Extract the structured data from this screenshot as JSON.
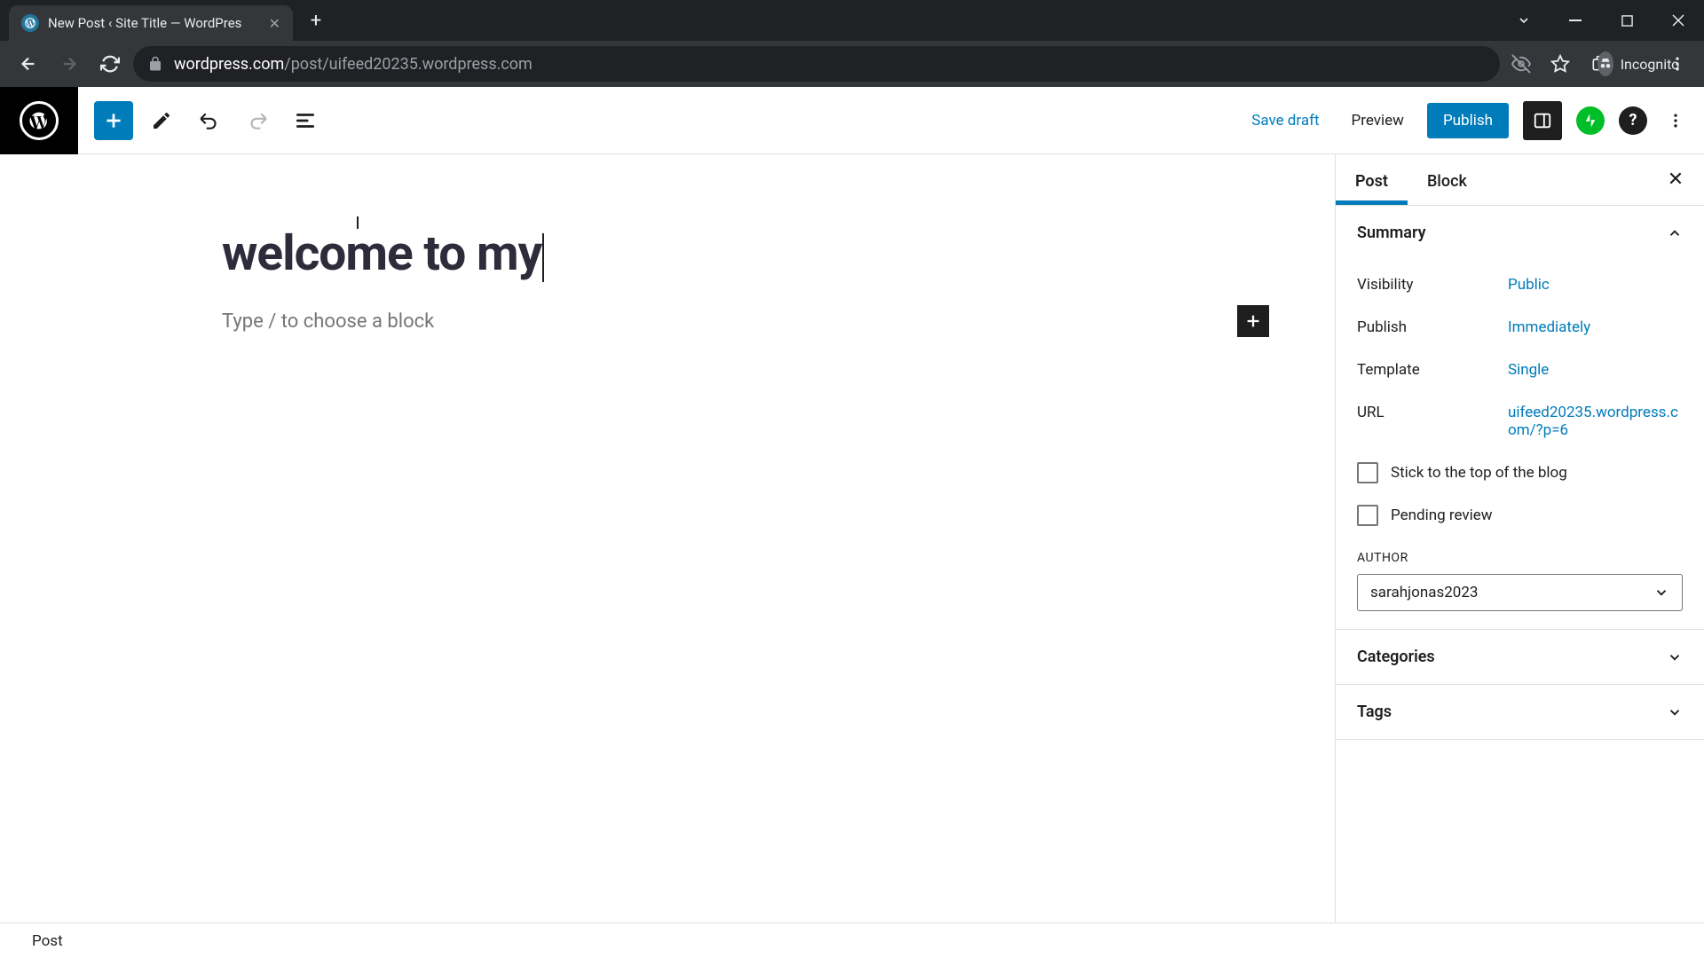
{
  "browser": {
    "tab_title": "New Post ‹ Site Title — WordPres",
    "url_domain": "wordpress.com",
    "url_path": "/post/uifeed20235.wordpress.com",
    "incognito_label": "Incognito"
  },
  "toolbar": {
    "save_draft": "Save draft",
    "preview": "Preview",
    "publish": "Publish"
  },
  "editor": {
    "title_value": "welcome to my",
    "block_placeholder": "Type / to choose a block"
  },
  "sidebar": {
    "tabs": {
      "post": "Post",
      "block": "Block"
    },
    "panels": {
      "summary": {
        "title": "Summary",
        "visibility_label": "Visibility",
        "visibility_value": "Public",
        "publish_label": "Publish",
        "publish_value": "Immediately",
        "template_label": "Template",
        "template_value": "Single",
        "url_label": "URL",
        "url_value": "uifeed20235.wordpress.com/?p=6",
        "stick_label": "Stick to the top of the blog",
        "pending_label": "Pending review",
        "author_heading": "AUTHOR",
        "author_value": "sarahjonas2023"
      },
      "categories": {
        "title": "Categories"
      },
      "tags": {
        "title": "Tags"
      }
    }
  },
  "status_bar": {
    "breadcrumb": "Post"
  }
}
